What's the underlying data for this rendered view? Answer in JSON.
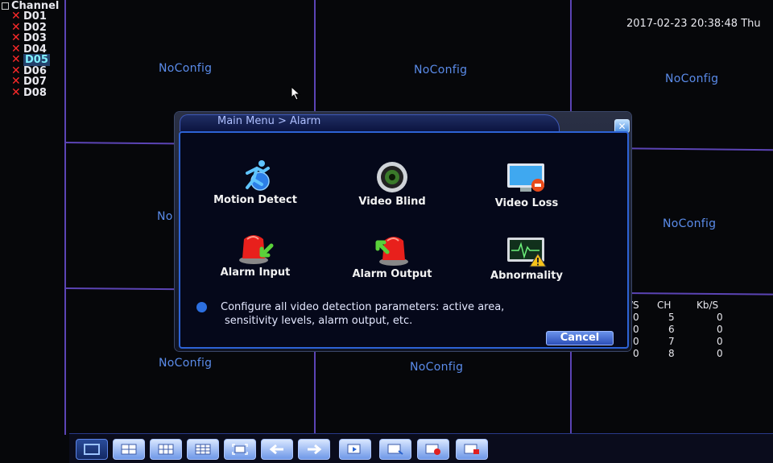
{
  "channel_panel": {
    "header": "Channel",
    "channels": [
      {
        "label": "D01",
        "status": "x"
      },
      {
        "label": "D02",
        "status": "x"
      },
      {
        "label": "D03",
        "status": "x"
      },
      {
        "label": "D04",
        "status": "x"
      },
      {
        "label": "D05",
        "status": "x",
        "selected": true
      },
      {
        "label": "D06",
        "status": "x"
      },
      {
        "label": "D07",
        "status": "x"
      },
      {
        "label": "D08",
        "status": "x"
      }
    ]
  },
  "datetime": "2017-02-23 20:38:48 Thu",
  "tiles": {
    "t1": "NoConfig",
    "t2": "NoConfig",
    "t3": "NoConfig",
    "t4": "No",
    "t5": "NoConfig",
    "t7": "NoConfig",
    "t8": "NoConfig"
  },
  "stats": {
    "headers": [
      "/S",
      "CH",
      "Kb/S"
    ],
    "rows": [
      [
        "0",
        "5",
        "0"
      ],
      [
        "0",
        "6",
        "0"
      ],
      [
        "0",
        "7",
        "0"
      ],
      [
        "0",
        "8",
        "0"
      ]
    ]
  },
  "dialog": {
    "title": "Main Menu > Alarm",
    "items": [
      {
        "label": "Motion Detect",
        "icon": "motion-detect-icon"
      },
      {
        "label": "Video Blind",
        "icon": "video-blind-icon"
      },
      {
        "label": "Video Loss",
        "icon": "video-loss-icon"
      },
      {
        "label": "Alarm Input",
        "icon": "alarm-input-icon"
      },
      {
        "label": "Alarm Output",
        "icon": "alarm-output-icon"
      },
      {
        "label": "Abnormality",
        "icon": "abnormality-icon"
      }
    ],
    "info_line1": "Configure all video detection parameters: active area,",
    "info_line2": "sensitivity levels, alarm output, etc.",
    "cancel_label": "Cancel"
  },
  "colors": {
    "grid_line": "#6b4fd3",
    "noconfig_text": "#5a8be9",
    "dialog_border": "#2d63d6",
    "channel_x": "#ff2a2a"
  }
}
